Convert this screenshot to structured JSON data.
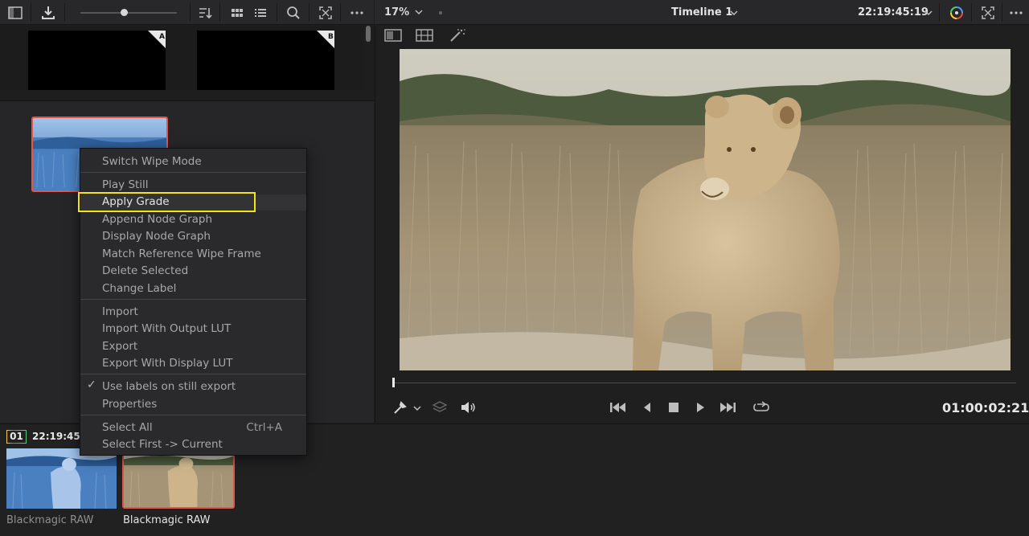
{
  "toolbar_left": {
    "icons": [
      "sidebar-toggle-icon",
      "import-still-icon",
      "sort-icon",
      "grid-view-icon",
      "list-view-icon",
      "search-icon",
      "expand-icon",
      "more-icon"
    ]
  },
  "viewer_toolbar": {
    "zoom": "17%",
    "timeline_title": "Timeline 1",
    "timecode": "22:19:45:19",
    "icons": [
      "color-wheel-icon",
      "fullscreen-icon",
      "more-icon"
    ]
  },
  "memories": [
    "A",
    "B"
  ],
  "context_menu": {
    "items": [
      {
        "label": "Switch Wipe Mode"
      },
      {
        "label": "Play Still"
      },
      {
        "label": "Apply Grade",
        "highlighted": true
      },
      {
        "label": "Append Node Graph"
      },
      {
        "label": "Display Node Graph"
      },
      {
        "label": "Match Reference Wipe Frame"
      },
      {
        "label": "Delete Selected"
      },
      {
        "label": "Change Label"
      },
      {
        "label": "Import"
      },
      {
        "label": "Import With Output LUT"
      },
      {
        "label": "Export"
      },
      {
        "label": "Export With Display LUT"
      },
      {
        "label": "Use labels on still export",
        "checked": true
      },
      {
        "label": "Properties"
      },
      {
        "label": "Select All",
        "shortcut": "Ctrl+A"
      },
      {
        "label": "Select First -> Current"
      }
    ],
    "check_mark": "✓"
  },
  "transport": {
    "timecode": "01:00:02:21"
  },
  "clips": [
    {
      "number": "01",
      "timecode": "22:19:45:",
      "name": "Blackmagic RAW",
      "selected": false
    },
    {
      "name": "Blackmagic RAW",
      "selected": true
    }
  ],
  "colors": {
    "accent_selection": "#e0564a",
    "highlight_box": "#f4e512"
  }
}
